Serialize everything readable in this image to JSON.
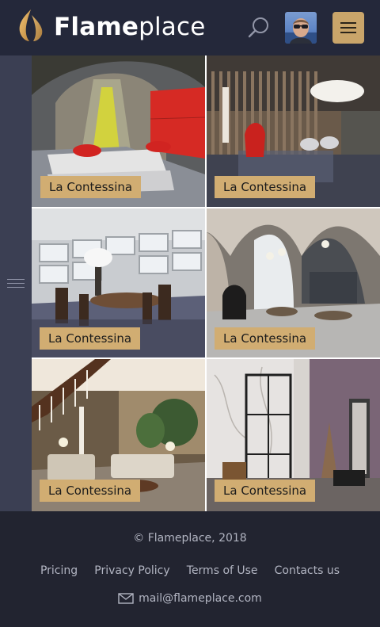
{
  "header": {
    "brand_bold": "Flame",
    "brand_light": "place",
    "icons": {
      "logo": "flame-logo-icon",
      "search": "search-icon",
      "avatar": "user-avatar",
      "menu": "hamburger-menu-icon"
    }
  },
  "sidebar": {
    "toggle_icon": "sidebar-toggle-icon"
  },
  "gallery": {
    "tiles": [
      {
        "label": "La Contessina",
        "scene": "escalator-lounge"
      },
      {
        "label": "La Contessina",
        "scene": "lobby-cloud-lamp"
      },
      {
        "label": "La Contessina",
        "scene": "dining-room"
      },
      {
        "label": "La Contessina",
        "scene": "arched-atrium"
      },
      {
        "label": "La Contessina",
        "scene": "showroom-staircase"
      },
      {
        "label": "La Contessina",
        "scene": "bathroom-shower"
      }
    ]
  },
  "footer": {
    "copyright": "© Flameplace, 2018",
    "links": [
      "Pricing",
      "Privacy Policy",
      "Terms of Use",
      "Contacts us"
    ],
    "email": "mail@flameplace.com",
    "email_icon": "mail-icon"
  },
  "colors": {
    "header_bg": "#24283a",
    "sidebar_bg": "#3b3f53",
    "footer_bg": "#222430",
    "accent_gold": "#c9a56a",
    "tag_bg": "#d1ad72",
    "footer_text": "#b2b5c2"
  }
}
